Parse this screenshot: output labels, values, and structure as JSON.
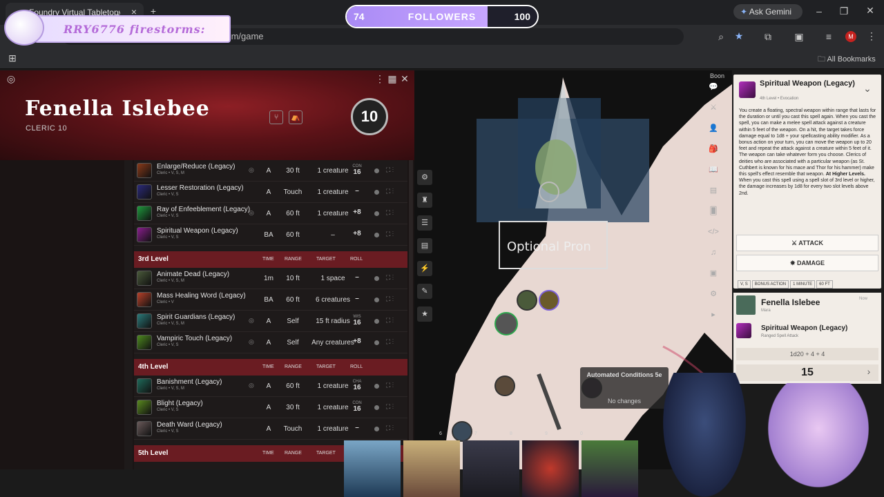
{
  "browser": {
    "tab_title": "Foundry Virtual Tabletop",
    "url": "g.com/game",
    "ask_gemini": "Ask Gemini",
    "all_bookmarks": "All Bookmarks",
    "avatar_letter": "M"
  },
  "overlay": {
    "names": "RRY6776  firestorms:",
    "followers": {
      "label": "FOLLOWERS",
      "current": "74",
      "goal": "100",
      "progress": 0.74
    }
  },
  "character": {
    "name": "Fenella Islebee",
    "class_level": "CLERIC 10",
    "level": "10"
  },
  "spells": {
    "level2_rows": [
      {
        "name": "Enlarge/Reduce (Legacy)",
        "sub": "Cleric • V, S, M",
        "time": "A",
        "range": "30 ft",
        "target": "1 creature",
        "roll": "16",
        "roll_sub": "CON",
        "conc": true,
        "color": "#8a3a1a"
      },
      {
        "name": "Lesser Restoration (Legacy)",
        "sub": "Cleric • V, S",
        "time": "A",
        "range": "Touch",
        "target": "1 creature",
        "roll": "–",
        "roll_sub": "",
        "conc": false,
        "color": "#2b2a7a"
      },
      {
        "name": "Ray of Enfeeblement (Legacy)",
        "sub": "Cleric • V, S",
        "time": "A",
        "range": "60 ft",
        "target": "1 creature",
        "roll": "+8",
        "roll_sub": "",
        "conc": true,
        "color": "#1f9a3d"
      },
      {
        "name": "Spiritual Weapon (Legacy)",
        "sub": "Cleric • V, S",
        "time": "BA",
        "range": "60 ft",
        "target": "–",
        "roll": "+8",
        "roll_sub": "",
        "conc": false,
        "color": "#8a1f8e"
      }
    ],
    "level3": {
      "label": "3rd Level",
      "cols": [
        "TIME",
        "RANGE",
        "TARGET",
        "ROLL"
      ]
    },
    "level3_rows": [
      {
        "name": "Animate Dead (Legacy)",
        "sub": "Cleric • V, S, M",
        "time": "1m",
        "range": "10 ft",
        "target": "1 space",
        "roll": "–",
        "roll_sub": "",
        "conc": false,
        "color": "#4a5a3a"
      },
      {
        "name": "Mass Healing Word (Legacy)",
        "sub": "Cleric • V",
        "time": "BA",
        "range": "60 ft",
        "target": "6 creatures",
        "roll": "–",
        "roll_sub": "",
        "conc": false,
        "color": "#b8412a"
      },
      {
        "name": "Spirit Guardians (Legacy)",
        "sub": "Cleric • V, S, M",
        "time": "A",
        "range": "Self",
        "target": "15 ft radius",
        "roll": "16",
        "roll_sub": "WIS",
        "conc": true,
        "color": "#2b7a7a"
      },
      {
        "name": "Vampiric Touch (Legacy)",
        "sub": "Cleric • V, S",
        "time": "A",
        "range": "Self",
        "target": "Any creatures",
        "roll": "+8",
        "roll_sub": "",
        "conc": true,
        "color": "#4e8a1f"
      }
    ],
    "level4": {
      "label": "4th Level",
      "cols": [
        "TIME",
        "RANGE",
        "TARGET",
        "ROLL"
      ]
    },
    "level4_rows": [
      {
        "name": "Banishment (Legacy)",
        "sub": "Cleric • V, S, M",
        "time": "A",
        "range": "60 ft",
        "target": "1 creature",
        "roll": "16",
        "roll_sub": "CHA",
        "conc": true,
        "color": "#1f6a5a"
      },
      {
        "name": "Blight (Legacy)",
        "sub": "Cleric • V, S",
        "time": "A",
        "range": "30 ft",
        "target": "1 creature",
        "roll": "16",
        "roll_sub": "CON",
        "conc": false,
        "color": "#5a8a1f"
      },
      {
        "name": "Death Ward (Legacy)",
        "sub": "Cleric • V, S",
        "time": "A",
        "range": "Touch",
        "target": "1 creature",
        "roll": "–",
        "roll_sub": "",
        "conc": false,
        "color": "#6a5a5a"
      }
    ],
    "level5": {
      "label": "5th Level",
      "cols": [
        "TIME",
        "RANGE",
        "TARGET"
      ]
    }
  },
  "map": {
    "prompt": "Optional Pron",
    "conditions_title": "Automated Conditions 5e",
    "conditions_status": "No changes",
    "hotbar": [
      "6",
      "7",
      "8",
      "9",
      "0"
    ]
  },
  "spell_card": {
    "title": "Spiritual Weapon (Legacy)",
    "subtitle": "4th Level • Evocation",
    "description": "You create a floating, spectral weapon within range that lasts for the duration or until you cast this spell again. When you cast the spell, you can make a melee spell attack against a creature within 5 feet of the weapon. On a hit, the target takes force damage equal to 1d8 + your spellcasting ability modifier. As a bonus action on your turn, you can move the weapon up to 20 feet and repeat the attack against a creature within 5 feet of it. The weapon can take whatever form you choose. Clerics of deities who are associated with a particular weapon (as St. Cuthbert is known for his mace and Thor for his hammer) make this spell's effect resemble that weapon.",
    "higher_label": "At Higher Levels.",
    "higher_text": "When you cast this spell using a spell slot of 3rd level or higher, the damage increases by 1d8 for every two slot levels above 2nd.",
    "attack_label": "ATTACK",
    "damage_label": "DAMAGE",
    "tags": [
      "V, S",
      "BONUS ACTION",
      "1 MINUTE",
      "60 FT"
    ]
  },
  "roll_card": {
    "speaker": "Fenella Islebee",
    "speaker_sub": "Mara",
    "time": "Now",
    "spell": "Spiritual Weapon (Legacy)",
    "spell_sub": "Ranged Spell Attack",
    "formula": "1d20 + 4 + 4",
    "total": "15"
  },
  "sidebar": {
    "boon": "Boon"
  }
}
